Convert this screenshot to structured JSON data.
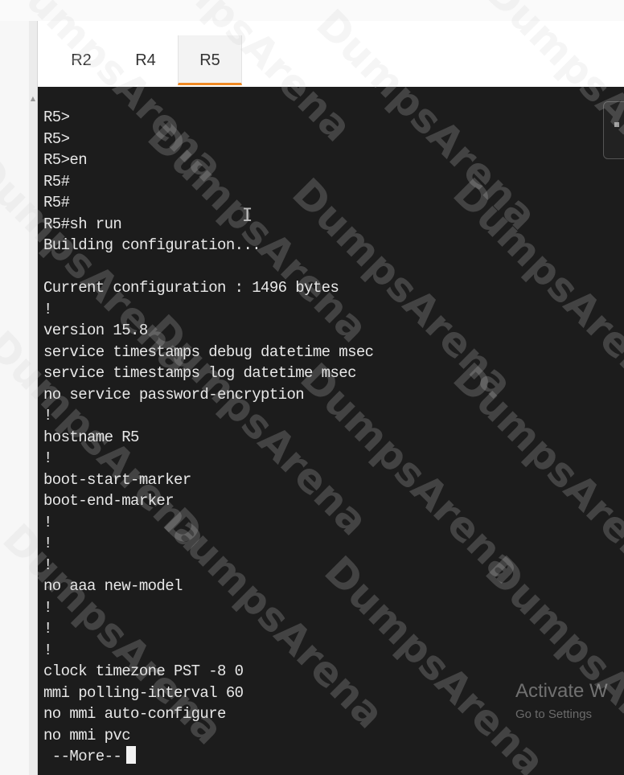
{
  "tabs": [
    {
      "label": "R2",
      "active": false
    },
    {
      "label": "R4",
      "active": false
    },
    {
      "label": "R5",
      "active": true
    }
  ],
  "terminal": {
    "lines": [
      "R5>",
      "R5>",
      "R5>en",
      "R5#",
      "R5#",
      "R5#sh run",
      "Building configuration...",
      "",
      "Current configuration : 1496 bytes",
      "!",
      "version 15.8",
      "service timestamps debug datetime msec",
      "service timestamps log datetime msec",
      "no service password-encryption",
      "!",
      "hostname R5",
      "!",
      "boot-start-marker",
      "boot-end-marker",
      "!",
      "!",
      "!",
      "no aaa new-model",
      "!",
      "!",
      "!",
      "clock timezone PST -8 0",
      "mmi polling-interval 60",
      "no mmi auto-configure",
      "no mmi pvc"
    ],
    "more_prompt": " --More--"
  },
  "overlay": {
    "activate_title": "Activate W",
    "activate_subtitle": "Go to Settings"
  },
  "watermark": {
    "text": "DumpsArena"
  },
  "colors": {
    "terminal_bg": "#1c1c1c",
    "terminal_fg": "#e8e8e8",
    "active_tab_indicator": "#f08a24"
  }
}
